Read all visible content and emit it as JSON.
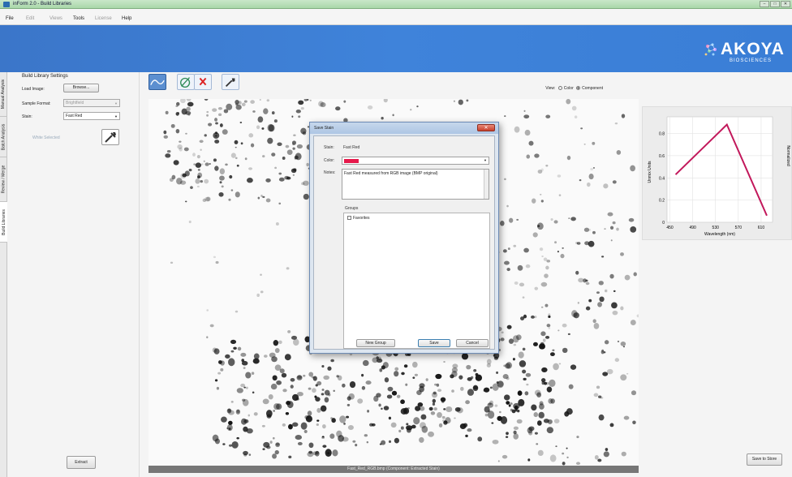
{
  "window": {
    "title": "inForm 2.0 - Build Libraries",
    "controls": [
      "–",
      "□",
      "✕"
    ]
  },
  "menu": [
    {
      "label": "File",
      "enabled": true
    },
    {
      "label": "Edit",
      "enabled": false
    },
    {
      "label": "Views",
      "enabled": false
    },
    {
      "label": "Tools",
      "enabled": true
    },
    {
      "label": "License",
      "enabled": false
    },
    {
      "label": "Help",
      "enabled": true
    }
  ],
  "logo": {
    "name": "AKOYA",
    "subtitle": "BIOSCIENCES"
  },
  "vtabs": [
    "Manual Analysis",
    "Batch Analysis",
    "Review / Merge",
    "Build Libraries"
  ],
  "left_panel": {
    "title": "Build Library Settings",
    "load_image_label": "Load Image:",
    "browse_label": "Browse...",
    "sample_format_label": "Sample Format:",
    "sample_format_value": "Brightfield",
    "stain_label": "Stain:",
    "stain_value": "Fast Red",
    "hint": "White Selected",
    "extract_label": "Extract"
  },
  "toolbar": {
    "view_label": "View:",
    "view_options": [
      "Color",
      "Component"
    ],
    "view_selected": "Component"
  },
  "status": "Fast_Red_RGB.bmp (Component: Extracted Stain)",
  "chart_data": {
    "type": "line",
    "x": [
      460,
      550,
      620
    ],
    "series": [
      {
        "values": [
          0.43,
          0.88,
          0.06
        ],
        "color": "#c2185b"
      }
    ],
    "xticks": [
      450,
      490,
      530,
      570,
      610
    ],
    "yticks": [
      0,
      0.2,
      0.4,
      0.6,
      0.8
    ],
    "xlabel": "Wavelength (nm)",
    "ylabel": "Unmix Units",
    "y2label": "Normalized",
    "xlim": [
      445,
      630
    ],
    "ylim": [
      0,
      0.95
    ]
  },
  "save_store_label": "Save to Store",
  "dialog": {
    "title": "Save Stain",
    "stain_label": "Stain:",
    "stain_value": "Fast Red",
    "color_label": "Color:",
    "color_value": "#e6194b",
    "notes_label": "Notes:",
    "notes_value": "Fast Red measured from RGB image (BMP original)",
    "groups_label": "Groups",
    "groups": [
      {
        "label": "Favorites",
        "checked": false
      }
    ],
    "new_group_label": "New Group",
    "save_label": "Save",
    "cancel_label": "Cancel"
  }
}
